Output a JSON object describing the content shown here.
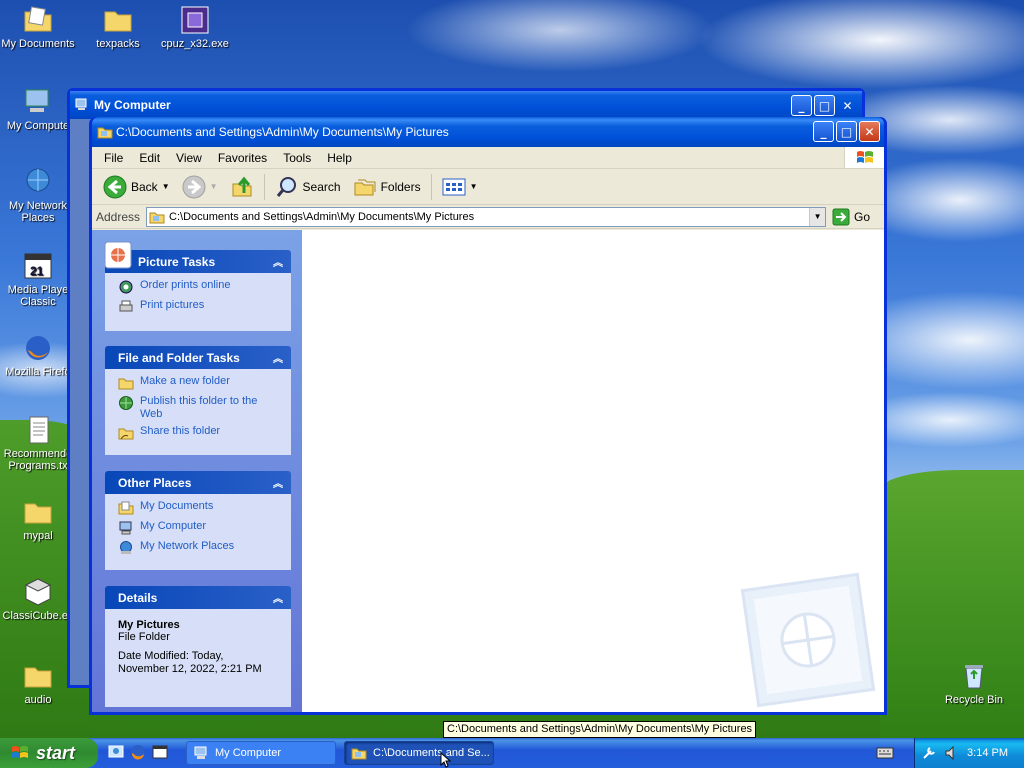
{
  "desktop": {
    "icons": [
      {
        "label": "My Documents"
      },
      {
        "label": "texpacks"
      },
      {
        "label": "cpuz_x32.exe"
      },
      {
        "label": "My Compute"
      },
      {
        "label": "My Network Places"
      },
      {
        "label": "Media Playe Classic"
      },
      {
        "label": "Mozilla Firefo"
      },
      {
        "label": "Recommende Programs.tx"
      },
      {
        "label": "mypal"
      },
      {
        "label": "ClassiCube.ex"
      },
      {
        "label": "audio"
      },
      {
        "label": "Recycle Bin"
      }
    ]
  },
  "back_window": {
    "title": "My Computer"
  },
  "window": {
    "title": "C:\\Documents and Settings\\Admin\\My Documents\\My Pictures",
    "menu": [
      "File",
      "Edit",
      "View",
      "Favorites",
      "Tools",
      "Help"
    ],
    "toolbar": {
      "back": "Back",
      "search": "Search",
      "folders": "Folders"
    },
    "address": {
      "label": "Address",
      "value": "C:\\Documents and Settings\\Admin\\My Documents\\My Pictures",
      "go": "Go"
    },
    "panels": {
      "picture_tasks": {
        "title": "Picture Tasks",
        "items": [
          "Order prints online",
          "Print pictures"
        ]
      },
      "file_folder_tasks": {
        "title": "File and Folder Tasks",
        "items": [
          "Make a new folder",
          "Publish this folder to the Web",
          "Share this folder"
        ]
      },
      "other_places": {
        "title": "Other Places",
        "items": [
          "My Documents",
          "My Computer",
          "My Network Places"
        ]
      },
      "details": {
        "title": "Details",
        "name": "My Pictures",
        "type": "File Folder",
        "modified_line1": "Date Modified: Today,",
        "modified_line2": "November 12, 2022, 2:21 PM"
      }
    }
  },
  "tooltip": "C:\\Documents and Settings\\Admin\\My Documents\\My Pictures",
  "taskbar": {
    "start": "start",
    "tasks": [
      {
        "label": "My Computer",
        "active": false
      },
      {
        "label": "C:\\Documents and Se...",
        "active": true
      }
    ],
    "clock": "3:14 PM"
  },
  "colors": {
    "taskbar_blue": "#245edb",
    "start_green": "#3c9a3c",
    "task_link": "#215dc6",
    "panel_header": "#0847b8",
    "panel_body": "#d6dff7"
  }
}
